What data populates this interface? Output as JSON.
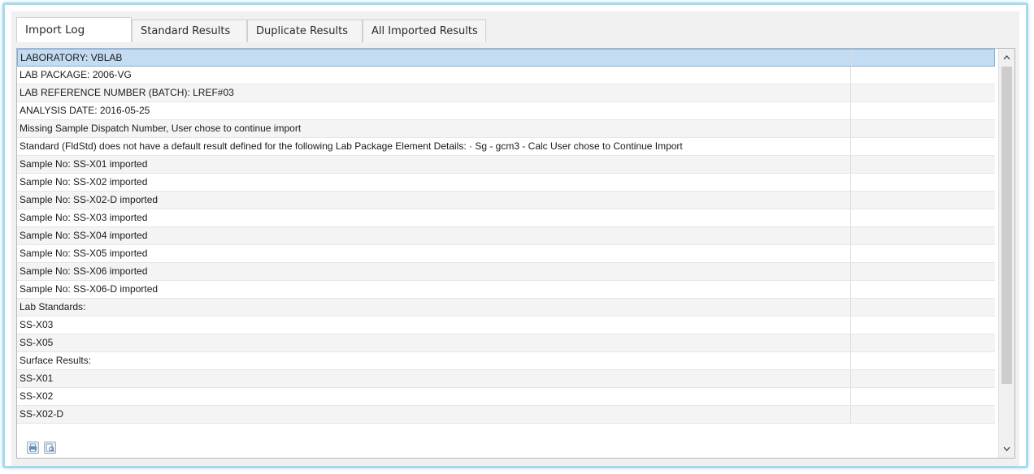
{
  "tabs": [
    {
      "label": "Import Log"
    },
    {
      "label": "Standard Results"
    },
    {
      "label": "Duplicate Results"
    },
    {
      "label": "All Imported Results"
    }
  ],
  "log_rows": [
    {
      "text": "LABORATORY:  VBLAB"
    },
    {
      "text": "LAB PACKAGE: 2006-VG"
    },
    {
      "text": "LAB REFERENCE NUMBER (BATCH): LREF#03"
    },
    {
      "text": "ANALYSIS DATE: 2016-05-25"
    },
    {
      "text": "Missing Sample Dispatch Number, User chose to continue import"
    },
    {
      "text": "Standard (FldStd) does not have a default result defined for the following Lab Package Element Details:     · Sg - gcm3 - Calc User chose to Continue Import"
    },
    {
      "text": "Sample No: SS-X01 imported"
    },
    {
      "text": "Sample No: SS-X02 imported"
    },
    {
      "text": "Sample No: SS-X02-D imported"
    },
    {
      "text": "Sample No: SS-X03 imported"
    },
    {
      "text": "Sample No: SS-X04 imported"
    },
    {
      "text": "Sample No: SS-X05 imported"
    },
    {
      "text": "Sample No: SS-X06 imported"
    },
    {
      "text": "Sample No: SS-X06-D imported"
    },
    {
      "text": "Lab Standards:"
    },
    {
      "text": "SS-X03"
    },
    {
      "text": "SS-X05"
    },
    {
      "text": "Surface Results:"
    },
    {
      "text": "SS-X01"
    },
    {
      "text": "SS-X02"
    },
    {
      "text": "SS-X02-D"
    }
  ],
  "icons": {
    "scroll_up": "chevron-up-icon",
    "scroll_down": "chevron-down-icon",
    "tool_1": "print-icon",
    "tool_2": "print-preview-icon"
  },
  "colors": {
    "selection": "#c4dcf2",
    "frame_glow": "#a8d8f0"
  }
}
